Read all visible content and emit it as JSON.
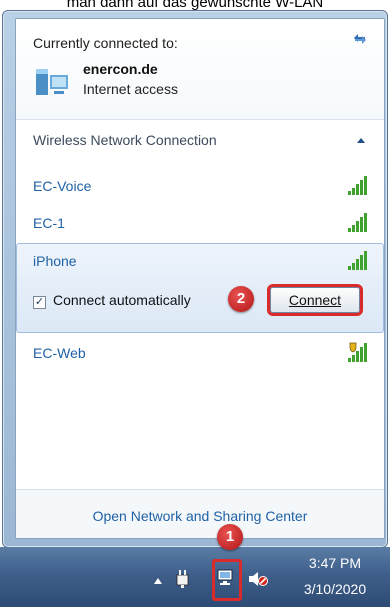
{
  "caption": "man dann auf das gewünschte W-LAN",
  "flyout": {
    "connected_label": "Currently connected to:",
    "current_network": {
      "name": "enercon.de",
      "status": "Internet access"
    },
    "section_title": "Wireless Network Connection",
    "networks": [
      {
        "name": "EC-Voice",
        "secured": false
      },
      {
        "name": "EC-1",
        "secured": false
      },
      {
        "name": "iPhone",
        "secured": false,
        "expanded": true
      },
      {
        "name": "EC-Web",
        "secured": true
      }
    ],
    "connect_auto_label": "Connect automatically",
    "connect_auto_checked": true,
    "connect_button": "Connect",
    "footer_link": "Open Network and Sharing Center"
  },
  "annotations": {
    "step1": "1",
    "step2": "2"
  },
  "taskbar": {
    "time": "3:47 PM",
    "date": "3/10/2020"
  },
  "colors": {
    "link": "#1f61a5",
    "highlight": "#d92b2b",
    "taskbar": "#3f5f8a"
  }
}
